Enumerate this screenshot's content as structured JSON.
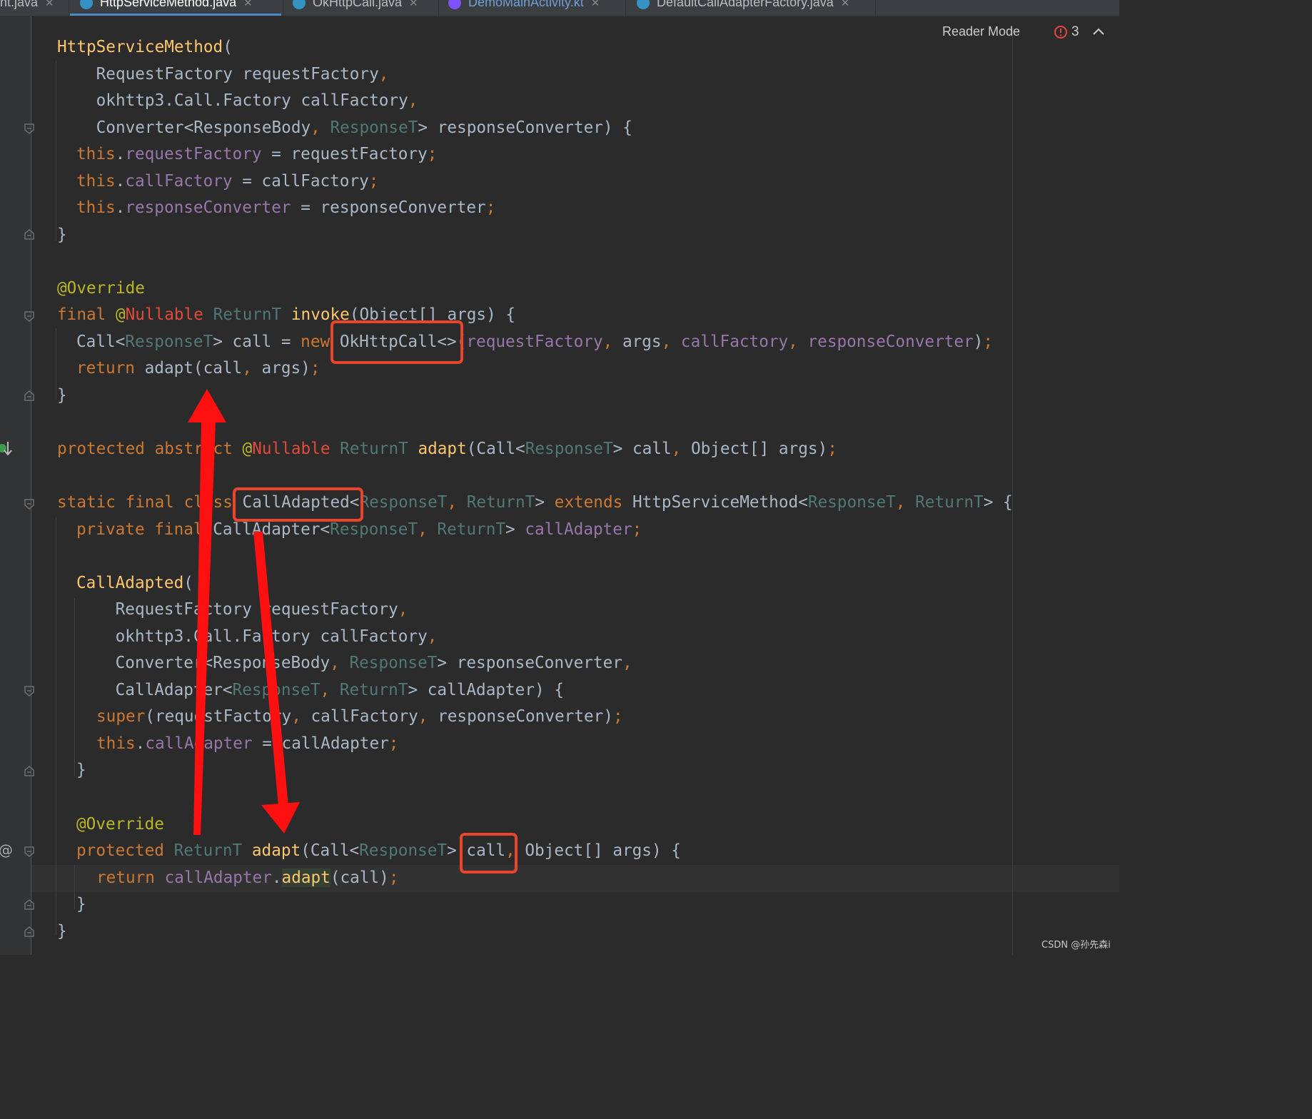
{
  "tabs": [
    {
      "label": "nt.java",
      "active": false
    },
    {
      "label": "HttpServiceMethod.java",
      "active": true
    },
    {
      "label": "OkHttpCall.java",
      "active": false
    },
    {
      "label": "DemoMainActivity.kt",
      "active": false
    },
    {
      "label": "DefaultCallAdapterFactory.java",
      "active": false
    }
  ],
  "toolbar": {
    "reader_mode_label": "Reader Mode",
    "problem_count": "3"
  },
  "code": {
    "l1": {
      "a": "HttpServiceMethod",
      "b": "("
    },
    "l2": {
      "a": "    RequestFactory requestFactory",
      "b": ","
    },
    "l3": {
      "a": "    okhttp3.Call.Factory callFactory",
      "b": ","
    },
    "l4": {
      "a": "    Converter<ResponseBody",
      "b": ", ",
      "c": "ResponseT",
      "d": "> responseConverter) {"
    },
    "l5": {
      "a": "this",
      "b": ".",
      "c": "requestFactory",
      "d": " = requestFactory",
      "e": ";"
    },
    "l6": {
      "a": "this",
      "b": ".",
      "c": "callFactory",
      "d": " = callFactory",
      "e": ";"
    },
    "l7": {
      "a": "this",
      "b": ".",
      "c": "responseConverter",
      "d": " = responseConverter",
      "e": ";"
    },
    "l8": {
      "a": "}"
    },
    "l9": {
      "a": "@Override"
    },
    "l10": {
      "a": "final ",
      "b": "@",
      "c": "Nullable",
      "d": " ",
      "e": "ReturnT",
      "f": " ",
      "g": "invoke",
      "h": "(Object[] args) {"
    },
    "l11": {
      "a": "Call<",
      "b": "ResponseT",
      "c": "> call = ",
      "d": "new ",
      "e": "OkHttpCall<>(",
      "f": "requestFactory",
      "g": ", ",
      "h": "args",
      "i": ", ",
      "j": "callFactory",
      "k": ", ",
      "l": "responseConverter",
      "m": ")",
      "n": ";"
    },
    "l12": {
      "a": "return ",
      "b": "adapt(call",
      "c": ", ",
      "d": "args)",
      "e": ";"
    },
    "l13": {
      "a": "}"
    },
    "l14": {
      "a": "protected abstract ",
      "b": "@",
      "c": "Nullable",
      "d": " ",
      "e": "ReturnT",
      "f": " ",
      "g": "adapt",
      "h": "(Call<",
      "i": "ResponseT",
      "j": "> call",
      "k": ", ",
      "l": "Object[] args)",
      "m": ";"
    },
    "l15": {
      "a": "static final class ",
      "b": "CallAdapted<",
      "c": "ResponseT",
      "d": ", ",
      "e": "ReturnT",
      "f": "> ",
      "g": "extends ",
      "h": "HttpServiceMethod<",
      "i": "ResponseT",
      "j": ", ",
      "k": "ReturnT",
      "l": "> {"
    },
    "l16": {
      "a": "private final ",
      "b": "CallAdapter<",
      "c": "ResponseT",
      "d": ", ",
      "e": "ReturnT",
      "f": "> ",
      "g": "callAdapter",
      "h": ";"
    },
    "l17": {
      "a": "CallAdapted",
      "b": "("
    },
    "l18": {
      "a": "    RequestFactory requestFactory",
      "b": ","
    },
    "l19": {
      "a": "    okhttp3.Call.Factory callFactory",
      "b": ","
    },
    "l20": {
      "a": "    Converter<ResponseBody",
      "b": ", ",
      "c": "ResponseT",
      "d": "> responseConverter",
      "e": ","
    },
    "l21": {
      "a": "    CallAdapter<",
      "b": "ResponseT",
      "c": ", ",
      "d": "ReturnT",
      "e": "> callAdapter) {"
    },
    "l22": {
      "a": "super",
      "b": "(requestFactory",
      "c": ", ",
      "d": "callFactory",
      "e": ", ",
      "f": "responseConverter)",
      "g": ";"
    },
    "l23": {
      "a": "this",
      "b": ".",
      "c": "callAdapter",
      "d": " = callAdapter",
      "e": ";"
    },
    "l24": {
      "a": "}"
    },
    "l25": {
      "a": "@Override"
    },
    "l26": {
      "a": "protected ",
      "b": "ReturnT",
      "c": " ",
      "d": "adapt",
      "e": "(Call<",
      "f": "ResponseT",
      "g": "> call",
      "h": ", ",
      "i": "Object[] args) {"
    },
    "l27": {
      "a": "return ",
      "b": "callAdapter",
      "c": ".",
      "d": "adapt",
      "e": "(call)",
      "f": ";"
    },
    "l28": {
      "a": "}"
    },
    "l29": {
      "a": "}"
    }
  },
  "gutter": {
    "override_marker": "O↓",
    "implements_marker": "@"
  },
  "colors": {
    "background": "#2b2b2b",
    "keyword": "#cc7832",
    "method": "#ffc66d",
    "field": "#9876aa",
    "annotation": "#bbb529",
    "type_param": "#507874",
    "highlight_box": "#e8452c",
    "arrow": "#ff1010"
  },
  "watermark": "CSDN @孙先森i"
}
